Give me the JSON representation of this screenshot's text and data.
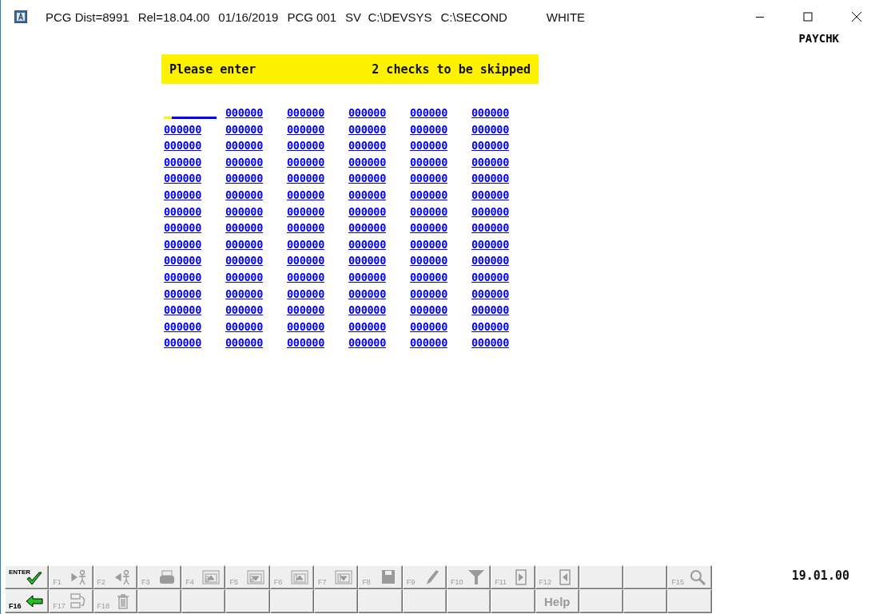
{
  "window": {
    "title_parts": [
      "PCG Dist=8991",
      "Rel=18.04.00",
      "01/16/2019",
      "PCG 001",
      "SV  C:\\DEVSYS",
      "C:\\SECOND"
    ],
    "user": "WHITE"
  },
  "screen_name": "PAYCHK",
  "message": {
    "prompt": "Please enter",
    "detail": "2 checks to be skipped"
  },
  "fields": [
    [
      {
        "focused": true
      },
      {
        "value": "000000",
        "focused": false
      },
      {
        "value": "000000",
        "focused": false
      },
      {
        "value": "000000",
        "focused": false
      },
      {
        "value": "000000",
        "focused": false
      },
      {
        "value": "000000",
        "focused": false
      }
    ],
    [
      {
        "value": "000000",
        "focused": false
      },
      {
        "value": "000000",
        "focused": false
      },
      {
        "value": "000000",
        "focused": false
      },
      {
        "value": "000000",
        "focused": false
      },
      {
        "value": "000000",
        "focused": false
      },
      {
        "value": "000000",
        "focused": false
      }
    ],
    [
      {
        "value": "000000",
        "focused": false
      },
      {
        "value": "000000",
        "focused": false
      },
      {
        "value": "000000",
        "focused": false
      },
      {
        "value": "000000",
        "focused": false
      },
      {
        "value": "000000",
        "focused": false
      },
      {
        "value": "000000",
        "focused": false
      }
    ],
    [
      {
        "value": "000000",
        "focused": false
      },
      {
        "value": "000000",
        "focused": false
      },
      {
        "value": "000000",
        "focused": false
      },
      {
        "value": "000000",
        "focused": false
      },
      {
        "value": "000000",
        "focused": false
      },
      {
        "value": "000000",
        "focused": false
      }
    ],
    [
      {
        "value": "000000",
        "focused": false
      },
      {
        "value": "000000",
        "focused": false
      },
      {
        "value": "000000",
        "focused": false
      },
      {
        "value": "000000",
        "focused": false
      },
      {
        "value": "000000",
        "focused": false
      },
      {
        "value": "000000",
        "focused": false
      }
    ],
    [
      {
        "value": "000000",
        "focused": false
      },
      {
        "value": "000000",
        "focused": false
      },
      {
        "value": "000000",
        "focused": false
      },
      {
        "value": "000000",
        "focused": false
      },
      {
        "value": "000000",
        "focused": false
      },
      {
        "value": "000000",
        "focused": false
      }
    ],
    [
      {
        "value": "000000",
        "focused": false
      },
      {
        "value": "000000",
        "focused": false
      },
      {
        "value": "000000",
        "focused": false
      },
      {
        "value": "000000",
        "focused": false
      },
      {
        "value": "000000",
        "focused": false
      },
      {
        "value": "000000",
        "focused": false
      }
    ],
    [
      {
        "value": "000000",
        "focused": false
      },
      {
        "value": "000000",
        "focused": false
      },
      {
        "value": "000000",
        "focused": false
      },
      {
        "value": "000000",
        "focused": false
      },
      {
        "value": "000000",
        "focused": false
      },
      {
        "value": "000000",
        "focused": false
      }
    ],
    [
      {
        "value": "000000",
        "focused": false
      },
      {
        "value": "000000",
        "focused": false
      },
      {
        "value": "000000",
        "focused": false
      },
      {
        "value": "000000",
        "focused": false
      },
      {
        "value": "000000",
        "focused": false
      },
      {
        "value": "000000",
        "focused": false
      }
    ],
    [
      {
        "value": "000000",
        "focused": false
      },
      {
        "value": "000000",
        "focused": false
      },
      {
        "value": "000000",
        "focused": false
      },
      {
        "value": "000000",
        "focused": false
      },
      {
        "value": "000000",
        "focused": false
      },
      {
        "value": "000000",
        "focused": false
      }
    ],
    [
      {
        "value": "000000",
        "focused": false
      },
      {
        "value": "000000",
        "focused": false
      },
      {
        "value": "000000",
        "focused": false
      },
      {
        "value": "000000",
        "focused": false
      },
      {
        "value": "000000",
        "focused": false
      },
      {
        "value": "000000",
        "focused": false
      }
    ],
    [
      {
        "value": "000000",
        "focused": false
      },
      {
        "value": "000000",
        "focused": false
      },
      {
        "value": "000000",
        "focused": false
      },
      {
        "value": "000000",
        "focused": false
      },
      {
        "value": "000000",
        "focused": false
      },
      {
        "value": "000000",
        "focused": false
      }
    ],
    [
      {
        "value": "000000",
        "focused": false
      },
      {
        "value": "000000",
        "focused": false
      },
      {
        "value": "000000",
        "focused": false
      },
      {
        "value": "000000",
        "focused": false
      },
      {
        "value": "000000",
        "focused": false
      },
      {
        "value": "000000",
        "focused": false
      }
    ],
    [
      {
        "value": "000000",
        "focused": false
      },
      {
        "value": "000000",
        "focused": false
      },
      {
        "value": "000000",
        "focused": false
      },
      {
        "value": "000000",
        "focused": false
      },
      {
        "value": "000000",
        "focused": false
      },
      {
        "value": "000000",
        "focused": false
      }
    ],
    [
      {
        "value": "000000",
        "focused": false
      },
      {
        "value": "000000",
        "focused": false
      },
      {
        "value": "000000",
        "focused": false
      },
      {
        "value": "000000",
        "focused": false
      },
      {
        "value": "000000",
        "focused": false
      },
      {
        "value": "000000",
        "focused": false
      }
    ]
  ],
  "function_keys": [
    [
      {
        "kind": "enter",
        "key": "ENTER",
        "disabled": false
      },
      {
        "kind": "person-right",
        "key": "F1",
        "disabled": true
      },
      {
        "kind": "person-left",
        "key": "F2",
        "disabled": true
      },
      {
        "kind": "printer",
        "key": "F3",
        "disabled": true
      },
      {
        "kind": "page-up-6",
        "key": "F4",
        "disabled": true
      },
      {
        "kind": "page-down-6",
        "key": "F5",
        "disabled": true
      },
      {
        "kind": "page-up-1",
        "key": "F6",
        "disabled": true
      },
      {
        "kind": "page-down-1",
        "key": "F7",
        "disabled": true
      },
      {
        "kind": "floppy",
        "key": "F8",
        "disabled": true
      },
      {
        "kind": "pencil",
        "key": "F9",
        "disabled": true
      },
      {
        "kind": "funnel",
        "key": "F10",
        "disabled": true
      },
      {
        "kind": "next",
        "key": "F11",
        "disabled": true
      },
      {
        "kind": "prev",
        "key": "F12",
        "disabled": true
      },
      {
        "kind": "blank"
      },
      {
        "kind": "blank"
      },
      {
        "kind": "magnifier",
        "key": "F15",
        "disabled": true
      }
    ],
    [
      {
        "kind": "back",
        "key": "F16",
        "disabled": false
      },
      {
        "kind": "swap",
        "key": "F17",
        "disabled": true
      },
      {
        "kind": "trash",
        "key": "F18",
        "disabled": true
      },
      {
        "kind": "blank"
      },
      {
        "kind": "blank"
      },
      {
        "kind": "blank"
      },
      {
        "kind": "blank"
      },
      {
        "kind": "blank"
      },
      {
        "kind": "blank"
      },
      {
        "kind": "blank"
      },
      {
        "kind": "blank"
      },
      {
        "kind": "blank"
      },
      {
        "kind": "text",
        "label": "Help",
        "disabled": true
      },
      {
        "kind": "blank"
      },
      {
        "kind": "blank"
      },
      {
        "kind": "blank"
      }
    ]
  ],
  "clock": "19.01.00"
}
